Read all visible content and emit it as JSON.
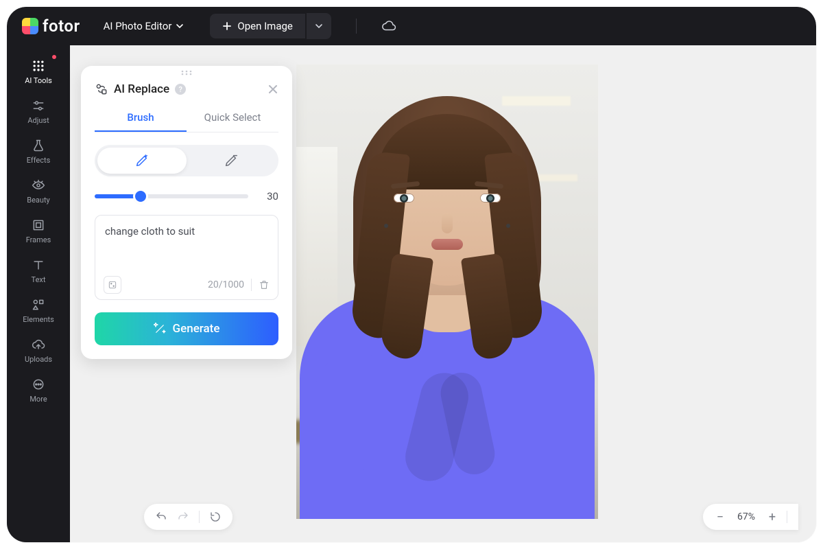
{
  "app": {
    "name": "fotor"
  },
  "header": {
    "editor_dropdown": "AI Photo Editor",
    "open_image": "Open Image"
  },
  "sidebar": {
    "items": [
      {
        "id": "ai-tools",
        "label": "AI Tools",
        "active": true,
        "badge": true
      },
      {
        "id": "adjust",
        "label": "Adjust"
      },
      {
        "id": "effects",
        "label": "Effects"
      },
      {
        "id": "beauty",
        "label": "Beauty"
      },
      {
        "id": "frames",
        "label": "Frames"
      },
      {
        "id": "text",
        "label": "Text"
      },
      {
        "id": "elements",
        "label": "Elements"
      },
      {
        "id": "uploads",
        "label": "Uploads"
      },
      {
        "id": "more",
        "label": "More"
      }
    ]
  },
  "panel": {
    "title": "AI Replace",
    "tabs": {
      "brush": "Brush",
      "quick_select": "Quick Select",
      "active": "brush"
    },
    "brush_size": 30,
    "prompt_text": "change cloth to suit",
    "char_count": "20/1000",
    "generate_label": "Generate"
  },
  "canvas": {
    "zoom_percent": "67%",
    "mask_color": "#6e6cf5"
  }
}
